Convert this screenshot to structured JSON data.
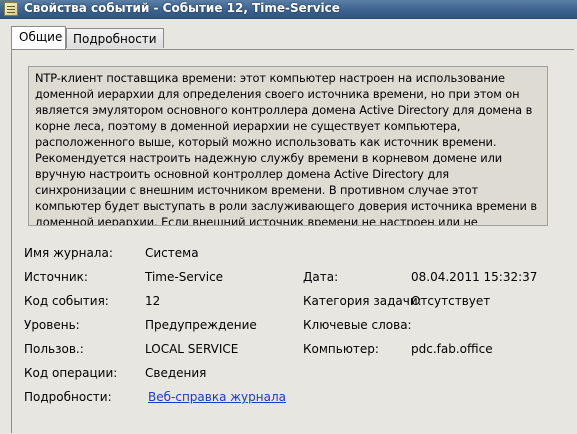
{
  "window": {
    "title": "Свойства событий - Событие 12, Time-Service"
  },
  "tabs": [
    {
      "label": "Общие"
    },
    {
      "label": "Подробности"
    }
  ],
  "description": "NTP-клиент поставщика времени: этот компьютер настроен на использование доменной иерархии для определения своего источника времени, но при этом он является эмулятором основного контроллера домена Active Directory для домена в корне леса, поэтому в доменной иерархии не существует компьютера, расположенного выше, который можно использовать как источник времени. Рекомендуется настроить надежную службу времени в корневом домене или вручную настроить основной контроллер домена Active Directory для синхронизации с внешним источником времени. В противном случае этот компьютер будет выступать в роли заслуживающего доверия источника времени в доменной иерархии. Если внешний источник времени не настроен или не используется для этого компьютера, можно отключить NTP-клиент.",
  "fields": {
    "log_name_label": "Имя журнала:",
    "log_name": "Система",
    "source_label": "Источник:",
    "source": "Time-Service",
    "date_label": "Дата:",
    "date": "08.04.2011 15:32:37",
    "event_id_label": "Код события:",
    "event_id": "12",
    "task_category_label": "Категория задачи:",
    "task_category": "Отсутствует",
    "level_label": "Уровень:",
    "level": "Предупреждение",
    "keywords_label": "Ключевые слова:",
    "keywords": "",
    "user_label": "Пользов.:",
    "user": "LOCAL SERVICE",
    "computer_label": "Компьютер:",
    "computer": "pdc.fab.office",
    "opcode_label": "Код операции:",
    "opcode": "Сведения",
    "more_info_label": "Подробности:",
    "more_info_link": "Веб-справка журнала"
  }
}
